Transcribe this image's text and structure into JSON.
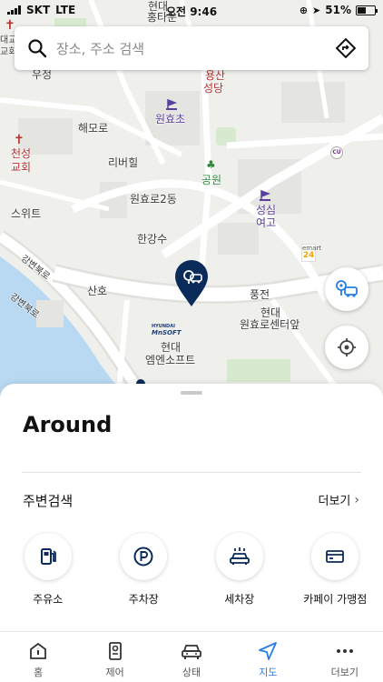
{
  "status_bar": {
    "carrier": "SKT",
    "network": "LTE",
    "time": "오전 9:46",
    "battery": "51%",
    "battery_level": 0.51
  },
  "search": {
    "placeholder": "장소, 주소 검색",
    "search_icon": "search-icon",
    "directions_icon": "directions-icon"
  },
  "map": {
    "labels": [
      "현대",
      "홍타운",
      "용산",
      "성당",
      "대교",
      "교회",
      "우정",
      "원효초",
      "해모로",
      "천성",
      "교회",
      "리버힐",
      "공원",
      "원효로2동",
      "성심",
      "여고",
      "스위트",
      "한강수",
      "강변북로",
      "강변북로",
      "산호",
      "풍전",
      "현대",
      "원효로센터앞",
      "현대",
      "엠엔소프트",
      "emart",
      "24",
      "CU",
      "HYUNDAI",
      "MnSOFT"
    ],
    "colors": {
      "land": "#efefec",
      "road": "#ffffff",
      "road_major": "#e2e2df",
      "river": "#b9d9f2",
      "park": "#d7ead0",
      "building": "#e4e4e1",
      "marker": "#0b2b5b"
    },
    "buttons": {
      "delivery_icon": "car-delivery-icon",
      "locate_icon": "my-location-icon"
    }
  },
  "sheet": {
    "title": "Around",
    "section_title": "주변검색",
    "more_label": "더보기",
    "categories": [
      {
        "label": "주유소",
        "icon": "gas-station-icon"
      },
      {
        "label": "주차장",
        "icon": "parking-icon"
      },
      {
        "label": "세차장",
        "icon": "car-wash-icon"
      },
      {
        "label": "카페이 가맹점",
        "icon": "card-payment-icon"
      }
    ]
  },
  "tabs": [
    {
      "label": "홈",
      "icon": "home-icon",
      "active": false
    },
    {
      "label": "제어",
      "icon": "remote-control-icon",
      "active": false
    },
    {
      "label": "상태",
      "icon": "car-status-icon",
      "active": false
    },
    {
      "label": "지도",
      "icon": "navigation-arrow-icon",
      "active": true
    },
    {
      "label": "더보기",
      "icon": "more-dots-icon",
      "active": false
    }
  ],
  "accent_color": "#2a7de1"
}
